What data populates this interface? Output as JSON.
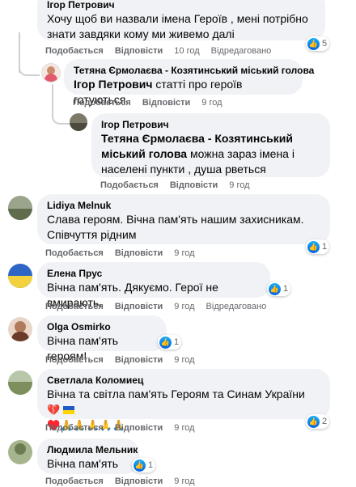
{
  "comments": [
    {
      "author": "Ігор Петрович",
      "text": "Хочу щоб ви назвали імена Героїв , мені потрібно знати завдяки кому ми живемо далі",
      "like": "Подобається",
      "reply": "Відповісти",
      "time": "10 год",
      "edited": "Відредаговано",
      "reactions": "5"
    },
    {
      "author": "Тетяна Єрмолаєва - Козятинський міський голова",
      "tag": "Ігор Петрович",
      "text": " статті про героїв готуються.",
      "like": "Подобається",
      "reply": "Відповісти",
      "time": "9 год"
    },
    {
      "author": "Ігор Петрович",
      "tag": "Тетяна Єрмолаєва - Козятинський міський голова",
      "text": " можна зараз імена і населені пункти , душа рветься",
      "like": "Подобається",
      "reply": "Відповісти",
      "time": "9 год"
    },
    {
      "author": "Lidiya Melnuk",
      "text": "Слава героям. Вічна пам'ять нашим захисникам. Співчуття рідним",
      "like": "Подобається",
      "reply": "Відповісти",
      "time": "9 год",
      "reactions": "1"
    },
    {
      "author": "Елена Прус",
      "text": "Вічна пам'ять. Дякуємо. Герої не вмирають.",
      "like": "Подобається",
      "reply": "Відповісти",
      "time": "9 год",
      "edited": "Відредаговано",
      "reactions": "1"
    },
    {
      "author": "Olga Osmirko",
      "text": "Вічна пам'ять героям!",
      "like": "Подобається",
      "reply": "Відповісти",
      "time": "9 год",
      "reactions": "1"
    },
    {
      "author": "Светлала Коломиец",
      "text": "Вічна та світла пам'ять Героям та Синам України",
      "emoji1": "💔",
      "emoji2": "♥️🙏🙏🙏🙏🙏",
      "like": "Подобається",
      "reply": "Відповісти",
      "time": "9 год",
      "reactions": "2"
    },
    {
      "author": "Людмила Мельник",
      "text": "Вічна пам'ять",
      "like": "Подобається",
      "reply": "Відповісти",
      "time": "9 год",
      "reactions": "1"
    }
  ],
  "icons": {
    "like": "like-thumb-icon"
  },
  "colors": {
    "bubble": "#f0f2f5",
    "like_blue": "#1877f2",
    "meta": "#65676b"
  }
}
